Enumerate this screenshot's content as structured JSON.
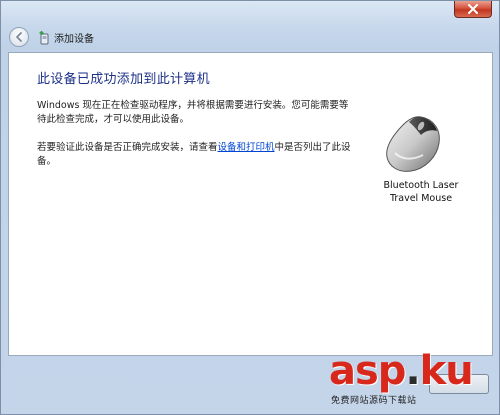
{
  "window": {
    "close_icon": "close-x-icon",
    "back_icon": "back-arrow-icon",
    "header_icon": "device-add-icon",
    "title": "添加设备"
  },
  "content": {
    "heading": "此设备已成功添加到此计算机",
    "paragraph1": "Windows 现在正在检查驱动程序，并将根据需要进行安装。您可能需要等待此检查完成，才可以使用此设备。",
    "paragraph2_before": "若要验证此设备是否正确完成安装，请查看",
    "paragraph2_link": "设备和打印机",
    "paragraph2_after": "中是否列出了此设备。"
  },
  "device": {
    "icon": "mouse-icon",
    "name_line1": "Bluetooth Laser",
    "name_line2": "Travel Mouse"
  },
  "watermark": {
    "text_prefix": "asp",
    "text_dot": ".",
    "text_suffix": "ku",
    "subtitle": "免费网站源码下载站"
  },
  "colors": {
    "heading": "#1e3287",
    "link": "#0046d5",
    "watermark": "#d8281c"
  }
}
